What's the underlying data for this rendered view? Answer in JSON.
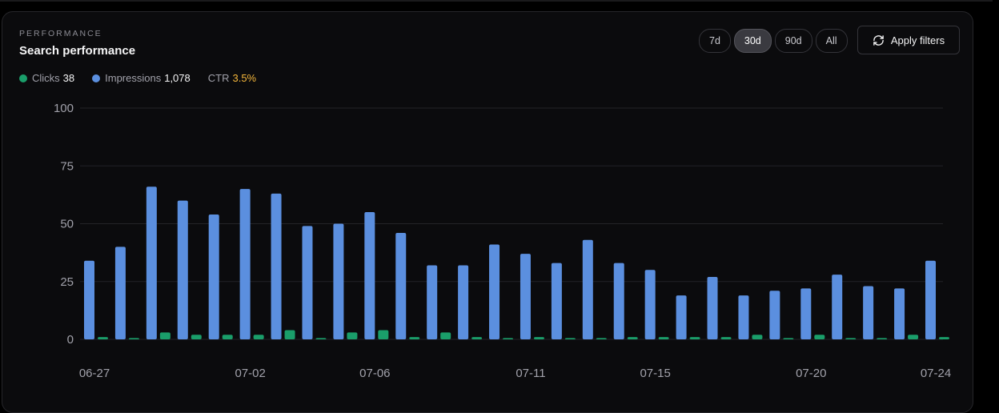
{
  "header": {
    "eyebrow": "PERFORMANCE",
    "title": "Search performance"
  },
  "legend": {
    "clicks_label": "Clicks",
    "clicks_value": "38",
    "impressions_label": "Impressions",
    "impressions_value": "1,078",
    "ctr_label": "CTR",
    "ctr_value": "3.5%"
  },
  "ranges": [
    {
      "label": "7d",
      "active": false
    },
    {
      "label": "30d",
      "active": true
    },
    {
      "label": "90d",
      "active": false
    },
    {
      "label": "All",
      "active": false
    }
  ],
  "apply_button": {
    "label": "Apply filters",
    "icon": "refresh-icon"
  },
  "colors": {
    "clicks": "#1a9e6a",
    "impressions": "#5b8fdf",
    "ctr": "#f5b73b",
    "grid": "#232327"
  },
  "chart_data": {
    "type": "bar",
    "title": "Search performance",
    "xlabel": "",
    "ylabel": "",
    "ylim": [
      0,
      100
    ],
    "yticks": [
      100,
      75,
      50,
      25,
      0
    ],
    "categories": [
      "06-27",
      "06-28",
      "06-29",
      "06-30",
      "07-01",
      "07-02",
      "07-03",
      "07-04",
      "07-05",
      "07-06",
      "07-07",
      "07-08",
      "07-09",
      "07-10",
      "07-11",
      "07-12",
      "07-13",
      "07-14",
      "07-15",
      "07-16",
      "07-17",
      "07-18",
      "07-19",
      "07-20",
      "07-21",
      "07-22",
      "07-23",
      "07-24"
    ],
    "xtick_labels": [
      "06-27",
      "07-02",
      "07-06",
      "07-11",
      "07-15",
      "07-20",
      "07-24"
    ],
    "series": [
      {
        "name": "Impressions",
        "values": [
          34,
          40,
          66,
          60,
          54,
          65,
          63,
          49,
          50,
          55,
          46,
          32,
          32,
          41,
          37,
          33,
          43,
          33,
          30,
          19,
          27,
          19,
          21,
          22,
          28,
          23,
          22,
          34
        ]
      },
      {
        "name": "Clicks",
        "values": [
          1,
          0,
          3,
          2,
          2,
          2,
          4,
          0,
          3,
          4,
          1,
          3,
          1,
          0,
          1,
          0,
          0,
          1,
          1,
          1,
          1,
          2,
          0,
          2,
          0,
          0,
          2,
          1
        ]
      }
    ],
    "grid": true,
    "legend": "top-left"
  }
}
